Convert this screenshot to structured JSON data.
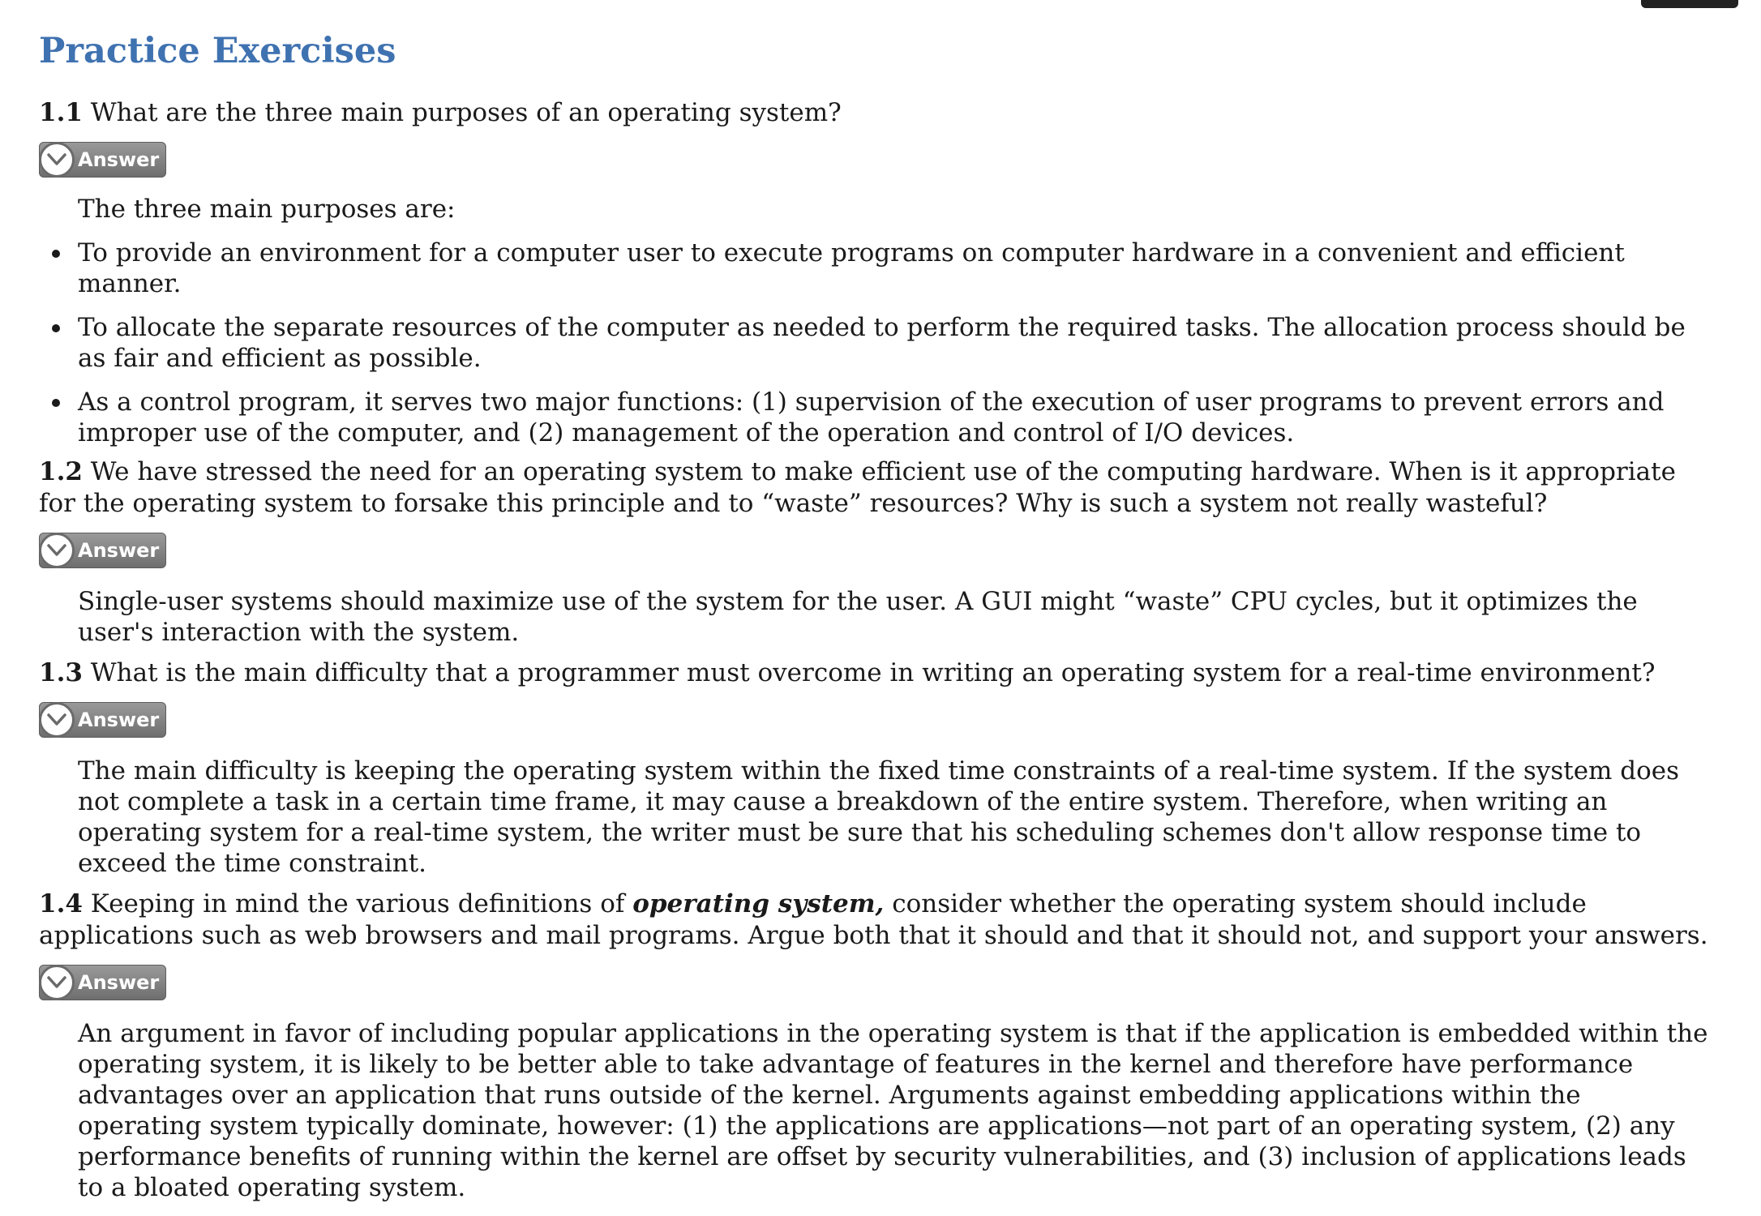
{
  "page": {
    "title": "Practice Exercises"
  },
  "answer_label": "Answer",
  "questions": [
    {
      "number": "1.1",
      "text": "What are the three main purposes of an operating system?",
      "answer_intro": "The three main purposes are:",
      "answer_bullets": [
        "To provide an environment for a computer user to execute programs on computer hardware in a convenient and efficient manner.",
        "To allocate the separate resources of the computer as needed to perform the required tasks. The allocation process should be as fair and efficient as possible.",
        "As a control program, it serves two major functions: (1) supervision of the execution of user programs to prevent errors and improper use of the computer, and (2) management of the operation and control of I/O devices."
      ]
    },
    {
      "number": "1.2",
      "text": "We have stressed the need for an operating system to make efficient use of the computing hardware. When is it appropriate for the operating system to forsake this principle and to “waste” resources? Why is such a system not really wasteful?",
      "answer": "Single-user systems should maximize use of the system for the user. A GUI might “waste” CPU cycles, but it optimizes the user's interaction with the system."
    },
    {
      "number": "1.3",
      "text": "What is the main difficulty that a programmer must overcome in writing an operating system for a real-time environment?",
      "answer": "The main difficulty is keeping the operating system within the fixed time constraints of a real-time system. If the system does not complete a task in a certain time frame, it may cause a breakdown of the entire system. Therefore, when writing an operating system for a real-time system, the writer must be sure that his scheduling schemes don't allow response time to exceed the time constraint."
    },
    {
      "number": "1.4",
      "text_before": "Keeping in mind the various definitions of",
      "text_emphasis": "operating system,",
      "text_after": "consider whether the operating system should include applications such as web browsers and mail programs. Argue both that it should and that it should not, and support your answers.",
      "answer": "An argument in favor of including popular applications in the operating system is that if the application is embedded within the operating system, it is likely to be better able to take advantage of features in the kernel and therefore have performance advantages over an application that runs outside of the kernel. Arguments against embedding applications within the operating system typically dominate, however: (1) the applications are applications—not part of an operating system, (2) any performance benefits of running within the kernel are offset by security vulnerabilities, and (3) inclusion of applications leads to a bloated operating system."
    }
  ],
  "colors": {
    "title": "#3f72b0",
    "text": "#1a1a1a",
    "answer_button": "#7f7f7f"
  },
  "icons": {
    "answer_toggle": "chevron-down-circle-icon"
  }
}
